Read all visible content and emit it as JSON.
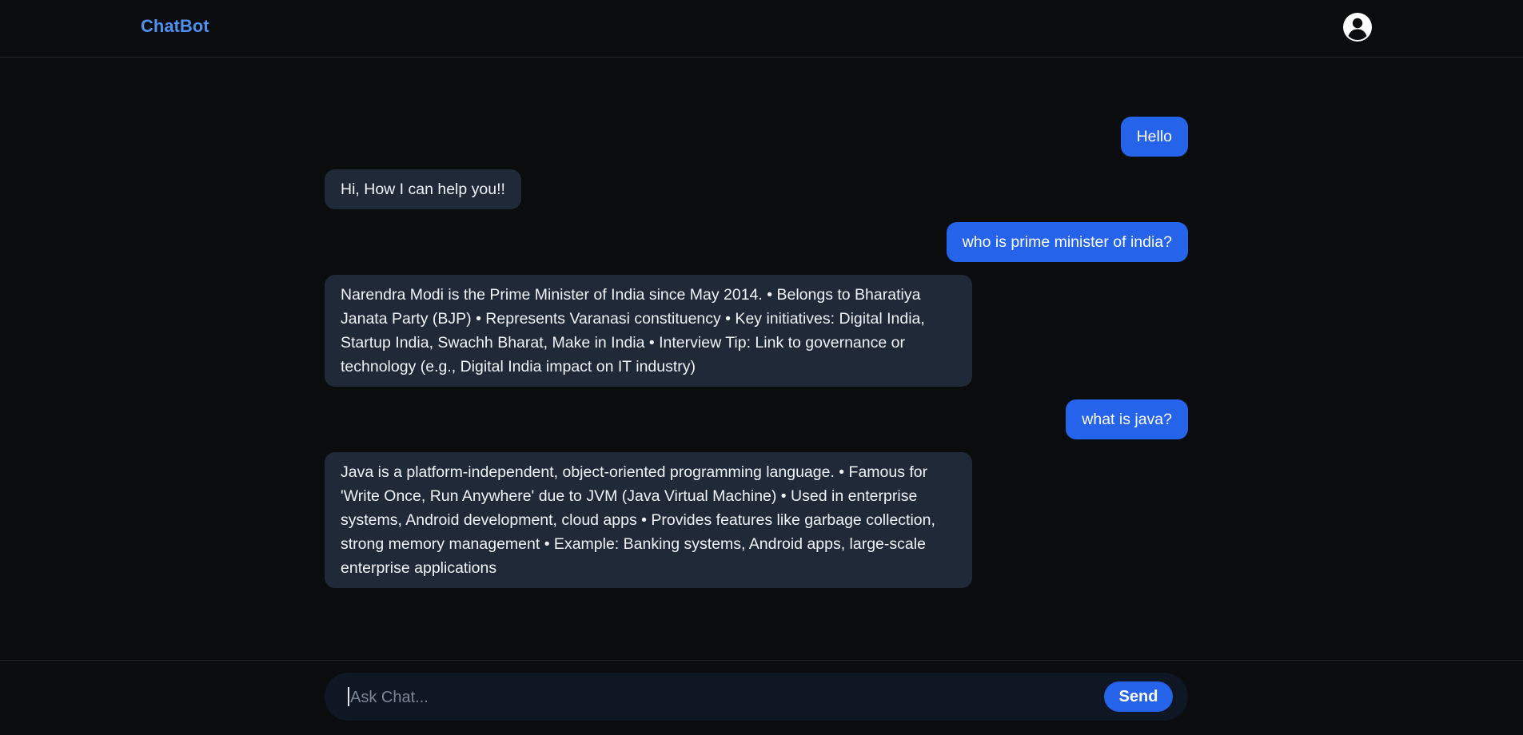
{
  "header": {
    "brand": "ChatBot",
    "profile_icon": "account-circle-icon"
  },
  "messages": [
    {
      "role": "user",
      "text": "Hello"
    },
    {
      "role": "bot",
      "text": "Hi, How I can help you!!"
    },
    {
      "role": "user",
      "text": "who is prime minister of india?"
    },
    {
      "role": "bot",
      "text": "Narendra Modi is the Prime Minister of India since May 2014. • Belongs to Bharatiya Janata Party (BJP) • Represents Varanasi constituency • Key initiatives: Digital India, Startup India, Swachh Bharat, Make in India • Interview Tip: Link to governance or technology (e.g., Digital India impact on IT industry)"
    },
    {
      "role": "user",
      "text": "what is java?"
    },
    {
      "role": "bot",
      "text": "Java is a platform-independent, object-oriented programming language. • Famous for 'Write Once, Run Anywhere' due to JVM (Java Virtual Machine) • Used in enterprise systems, Android development, cloud apps • Provides features like garbage collection, strong memory management • Example: Banking systems, Android apps, large-scale enterprise applications"
    }
  ],
  "composer": {
    "placeholder": "Ask Chat...",
    "value": "",
    "send_label": "Send"
  },
  "colors": {
    "background": "#0b0c0d",
    "brand": "#4f8ff0",
    "user_bubble": "#2563eb",
    "bot_bubble": "#1f2937",
    "composer_bg": "#0f1725"
  }
}
